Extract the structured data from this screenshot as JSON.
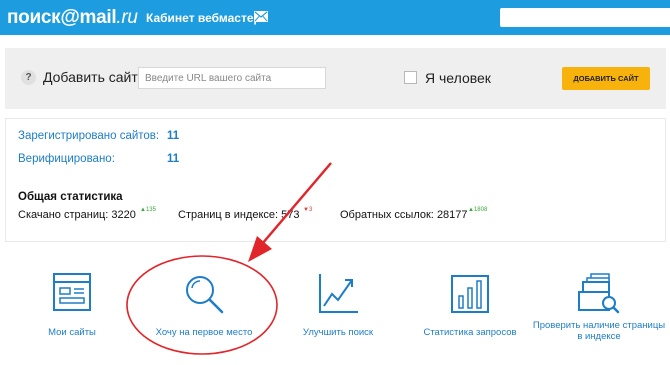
{
  "header": {
    "logo_text": "поиск",
    "logo_at": "@",
    "logo_mail": "mail",
    "logo_ru": ".ru",
    "cabinet_label": "Кабинет вебмастера",
    "search_placeholder": ""
  },
  "addbar": {
    "help_glyph": "?",
    "add_label": "Добавить сайт",
    "url_placeholder": "Введите URL вашего сайта",
    "human_label": "Я человек",
    "add_button_label": "Добавить сайт"
  },
  "stats": {
    "registered_label": "Зарегистрировано сайтов:",
    "registered_value": "11",
    "verified_label": "Верифицировано:",
    "verified_value": "11",
    "general_title": "Общая статистика",
    "downloaded_label": "Скачано страниц:",
    "downloaded_value": "3220",
    "downloaded_delta": "▲135",
    "indexed_label": "Страниц в индексе:",
    "indexed_value": "573",
    "indexed_delta": "▼3",
    "backlinks_label": "Обратных ссылок:",
    "backlinks_value": "28177",
    "backlinks_delta": "▲1808"
  },
  "actions": [
    {
      "label": "Мои сайты",
      "icon": "browser-window-icon"
    },
    {
      "label": "Хочу на первое место",
      "icon": "magnifier-icon"
    },
    {
      "label": "Улучшить поиск",
      "icon": "growth-chart-icon"
    },
    {
      "label": "Статистика запросов",
      "icon": "bar-chart-icon"
    },
    {
      "label": "Проверить наличие страницы в индексе",
      "icon": "document-search-icon"
    }
  ],
  "colors": {
    "header_bg": "#1e9ce0",
    "link_blue": "#1e7dc6",
    "button_yellow": "#f8b20c",
    "annotation_red": "#e0252b",
    "up_green": "#3aa63a",
    "down_red": "#e23b3b"
  }
}
